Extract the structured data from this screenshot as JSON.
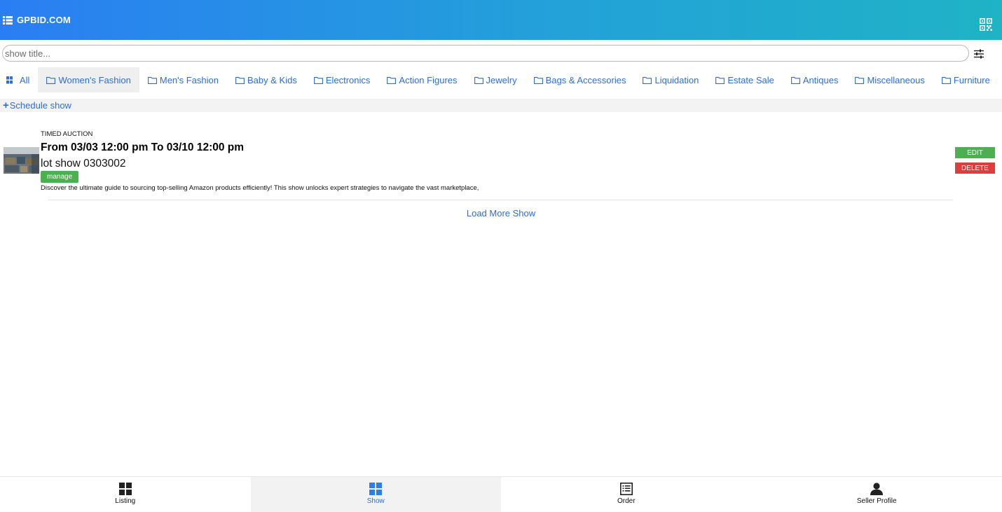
{
  "header": {
    "brand": "GPBID.COM",
    "brand_icon": "list-icon",
    "qr_icon": "qr-code-icon"
  },
  "search": {
    "placeholder": "show title...",
    "value": "",
    "filter_icon": "sliders-icon"
  },
  "categories": [
    {
      "label": "All",
      "icon": "grid-icon",
      "active": false
    },
    {
      "label": "Women's Fashion",
      "icon": "folder-icon",
      "active": true
    },
    {
      "label": "Men's Fashion",
      "icon": "folder-icon",
      "active": false
    },
    {
      "label": "Baby & Kids",
      "icon": "folder-icon",
      "active": false
    },
    {
      "label": "Electronics",
      "icon": "folder-icon",
      "active": false
    },
    {
      "label": "Action Figures",
      "icon": "folder-icon",
      "active": false
    },
    {
      "label": "Jewelry",
      "icon": "folder-icon",
      "active": false
    },
    {
      "label": "Bags & Accessories",
      "icon": "folder-icon",
      "active": false
    },
    {
      "label": "Liquidation",
      "icon": "folder-icon",
      "active": false
    },
    {
      "label": "Estate Sale",
      "icon": "folder-icon",
      "active": false
    },
    {
      "label": "Antiques",
      "icon": "folder-icon",
      "active": false
    },
    {
      "label": "Miscellaneous",
      "icon": "folder-icon",
      "active": false
    },
    {
      "label": "Furniture",
      "icon": "folder-icon",
      "active": false
    }
  ],
  "schedule": {
    "plus": "+",
    "label": "Schedule show"
  },
  "shows": [
    {
      "type": "TIMED AUCTION",
      "date_range": "From 03/03 12:00 pm To 03/10 12:00 pm",
      "title": "lot show 0303002",
      "manage_label": "manage",
      "description": "Discover the ultimate guide to sourcing top-selling Amazon products efficiently! This show unlocks expert strategies to navigate the vast marketplace,",
      "edit_label": "EDIT",
      "delete_label": "DELETE"
    }
  ],
  "load_more": "Load More Show",
  "bottom_nav": [
    {
      "label": "Listing",
      "icon": "grid-icon",
      "active": false
    },
    {
      "label": "Show",
      "icon": "grid-icon",
      "active": true
    },
    {
      "label": "Order",
      "icon": "list-alt-icon",
      "active": false
    },
    {
      "label": "Seller Profile",
      "icon": "user-icon",
      "active": false
    }
  ],
  "colors": {
    "header_gradient_start": "#2a7ef3",
    "header_gradient_end": "#1fb3c6",
    "link": "#2e6fc9",
    "success": "#4caf50",
    "danger": "#dc3d3d"
  }
}
